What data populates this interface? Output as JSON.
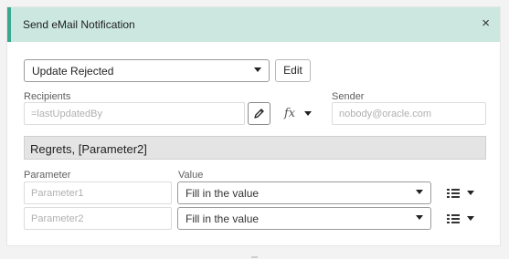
{
  "dialog": {
    "title": "Send eMail Notification",
    "close_glyph": "×"
  },
  "template": {
    "selected": "Update Rejected",
    "edit_label": "Edit"
  },
  "recipients": {
    "label": "Recipients",
    "placeholder": "=lastUpdatedBy",
    "edit_icon": "pencil-icon",
    "fx_glyph": "fx"
  },
  "sender": {
    "label": "Sender",
    "placeholder": "nobody@oracle.com"
  },
  "subject": {
    "text": "Regrets, [Parameter2]"
  },
  "params": {
    "col_parameter": "Parameter",
    "col_value": "Value",
    "rows": [
      {
        "name": "Parameter1",
        "value": "Fill in the value"
      },
      {
        "name": "Parameter2",
        "value": "Fill in the value"
      }
    ]
  },
  "colors": {
    "header_bg": "#cbe7e0",
    "header_accent": "#3aa88e"
  }
}
